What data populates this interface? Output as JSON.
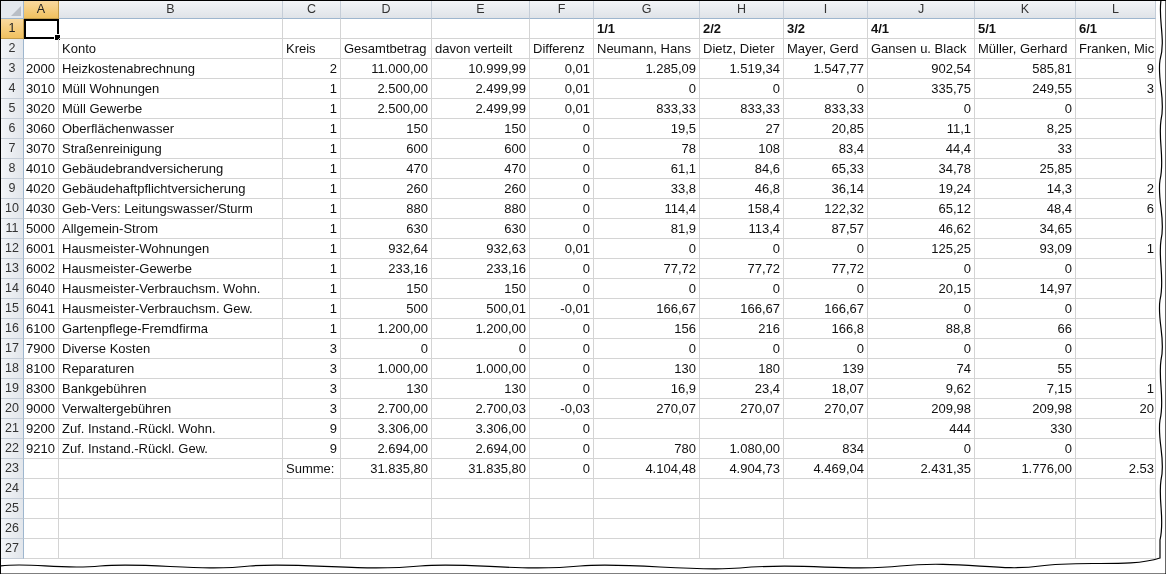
{
  "corner": {
    "kind": "select-all"
  },
  "columns": [
    {
      "letter": "A",
      "selected": true
    },
    {
      "letter": "B",
      "selected": false
    },
    {
      "letter": "C",
      "selected": false
    },
    {
      "letter": "D",
      "selected": false
    },
    {
      "letter": "E",
      "selected": false
    },
    {
      "letter": "F",
      "selected": false
    },
    {
      "letter": "G",
      "selected": false
    },
    {
      "letter": "H",
      "selected": false
    },
    {
      "letter": "I",
      "selected": false
    },
    {
      "letter": "J",
      "selected": false
    },
    {
      "letter": "K",
      "selected": false
    },
    {
      "letter": "L",
      "selected": false
    }
  ],
  "rows": [
    {
      "number": "1",
      "selected": true,
      "kind": "title",
      "cells": [
        null,
        null,
        null,
        null,
        null,
        null,
        "1/1",
        "2/2",
        "3/2",
        "4/1",
        "5/1",
        "6/1"
      ]
    },
    {
      "number": "2",
      "selected": false,
      "kind": "header",
      "cells": [
        null,
        "Konto",
        "Kreis",
        "Gesamtbetrag",
        "davon verteilt",
        "Differenz",
        "Neumann, Hans",
        "Dietz, Dieter",
        "Mayer, Gerd",
        "Gansen u. Black",
        "Müller, Gerhard",
        "Franken, Mic"
      ]
    },
    {
      "number": "3",
      "selected": false,
      "kind": "data",
      "cells": [
        "2000",
        "Heizkostenabrechnung",
        "2",
        "11.000,00",
        "10.999,99",
        "0,01",
        "1.285,09",
        "1.519,34",
        "1.547,77",
        "902,54",
        "585,81",
        "9"
      ]
    },
    {
      "number": "4",
      "selected": false,
      "kind": "data",
      "cells": [
        "3010",
        "Müll Wohnungen",
        "1",
        "2.500,00",
        "2.499,99",
        "0,01",
        "0",
        "0",
        "0",
        "335,75",
        "249,55",
        "3"
      ]
    },
    {
      "number": "5",
      "selected": false,
      "kind": "data",
      "cells": [
        "3020",
        "Müll Gewerbe",
        "1",
        "2.500,00",
        "2.499,99",
        "0,01",
        "833,33",
        "833,33",
        "833,33",
        "0",
        "0",
        null
      ]
    },
    {
      "number": "6",
      "selected": false,
      "kind": "data",
      "cells": [
        "3060",
        "Oberflächenwasser",
        "1",
        "150",
        "150",
        "0",
        "19,5",
        "27",
        "20,85",
        "11,1",
        "8,25",
        null
      ]
    },
    {
      "number": "7",
      "selected": false,
      "kind": "data",
      "cells": [
        "3070",
        "Straßenreinigung",
        "1",
        "600",
        "600",
        "0",
        "78",
        "108",
        "83,4",
        "44,4",
        "33",
        null
      ]
    },
    {
      "number": "8",
      "selected": false,
      "kind": "data",
      "cells": [
        "4010",
        "Gebäudebrandversicherung",
        "1",
        "470",
        "470",
        "0",
        "61,1",
        "84,6",
        "65,33",
        "34,78",
        "25,85",
        null
      ]
    },
    {
      "number": "9",
      "selected": false,
      "kind": "data",
      "cells": [
        "4020",
        "Gebäudehaftpflichtversicherung",
        "1",
        "260",
        "260",
        "0",
        "33,8",
        "46,8",
        "36,14",
        "19,24",
        "14,3",
        "2"
      ]
    },
    {
      "number": "10",
      "selected": false,
      "kind": "data",
      "cells": [
        "4030",
        "Geb-Vers: Leitungswasser/Sturm",
        "1",
        "880",
        "880",
        "0",
        "114,4",
        "158,4",
        "122,32",
        "65,12",
        "48,4",
        "6"
      ]
    },
    {
      "number": "11",
      "selected": false,
      "kind": "data",
      "cells": [
        "5000",
        "Allgemein-Strom",
        "1",
        "630",
        "630",
        "0",
        "81,9",
        "113,4",
        "87,57",
        "46,62",
        "34,65",
        null
      ]
    },
    {
      "number": "12",
      "selected": false,
      "kind": "data",
      "cells": [
        "6001",
        "Hausmeister-Wohnungen",
        "1",
        "932,64",
        "932,63",
        "0,01",
        "0",
        "0",
        "0",
        "125,25",
        "93,09",
        "1"
      ]
    },
    {
      "number": "13",
      "selected": false,
      "kind": "data",
      "cells": [
        "6002",
        "Hausmeister-Gewerbe",
        "1",
        "233,16",
        "233,16",
        "0",
        "77,72",
        "77,72",
        "77,72",
        "0",
        "0",
        null
      ]
    },
    {
      "number": "14",
      "selected": false,
      "kind": "data",
      "cells": [
        "6040",
        "Hausmeister-Verbrauchsm. Wohn.",
        "1",
        "150",
        "150",
        "0",
        "0",
        "0",
        "0",
        "20,15",
        "14,97",
        null
      ]
    },
    {
      "number": "15",
      "selected": false,
      "kind": "data",
      "cells": [
        "6041",
        "Hausmeister-Verbrauchsm. Gew.",
        "1",
        "500",
        "500,01",
        "-0,01",
        "166,67",
        "166,67",
        "166,67",
        "0",
        "0",
        null
      ]
    },
    {
      "number": "16",
      "selected": false,
      "kind": "data",
      "cells": [
        "6100",
        "Gartenpflege-Fremdfirma",
        "1",
        "1.200,00",
        "1.200,00",
        "0",
        "156",
        "216",
        "166,8",
        "88,8",
        "66",
        null
      ]
    },
    {
      "number": "17",
      "selected": false,
      "kind": "data",
      "cells": [
        "7900",
        "Diverse Kosten",
        "3",
        "0",
        "0",
        "0",
        "0",
        "0",
        "0",
        "0",
        "0",
        null
      ]
    },
    {
      "number": "18",
      "selected": false,
      "kind": "data",
      "cells": [
        "8100",
        "Reparaturen",
        "3",
        "1.000,00",
        "1.000,00",
        "0",
        "130",
        "180",
        "139",
        "74",
        "55",
        null
      ]
    },
    {
      "number": "19",
      "selected": false,
      "kind": "data",
      "cells": [
        "8300",
        "Bankgebühren",
        "3",
        "130",
        "130",
        "0",
        "16,9",
        "23,4",
        "18,07",
        "9,62",
        "7,15",
        "1"
      ]
    },
    {
      "number": "20",
      "selected": false,
      "kind": "data",
      "cells": [
        "9000",
        "Verwaltergebühren",
        "3",
        "2.700,00",
        "2.700,03",
        "-0,03",
        "270,07",
        "270,07",
        "270,07",
        "209,98",
        "209,98",
        "20"
      ]
    },
    {
      "number": "21",
      "selected": false,
      "kind": "data",
      "cells": [
        "9200",
        "Zuf. Instand.-Rückl. Wohn.",
        "9",
        "3.306,00",
        "3.306,00",
        "0",
        null,
        null,
        null,
        "444",
        "330",
        null
      ]
    },
    {
      "number": "22",
      "selected": false,
      "kind": "data",
      "cells": [
        "9210",
        "Zuf. Instand.-Rückl. Gew.",
        "9",
        "2.694,00",
        "2.694,00",
        "0",
        "780",
        "1.080,00",
        "834",
        "0",
        "0",
        null
      ]
    },
    {
      "number": "23",
      "selected": false,
      "kind": "total",
      "cells": [
        null,
        null,
        "Summe:",
        "31.835,80",
        "31.835,80",
        "0",
        "4.104,48",
        "4.904,73",
        "4.469,04",
        "2.431,35",
        "1.776,00",
        "2.53"
      ]
    },
    {
      "number": "24",
      "selected": false,
      "kind": "empty",
      "cells": []
    },
    {
      "number": "25",
      "selected": false,
      "kind": "empty",
      "cells": []
    },
    {
      "number": "26",
      "selected": false,
      "kind": "empty",
      "cells": []
    },
    {
      "number": "27",
      "selected": false,
      "kind": "empty",
      "cells": []
    }
  ]
}
